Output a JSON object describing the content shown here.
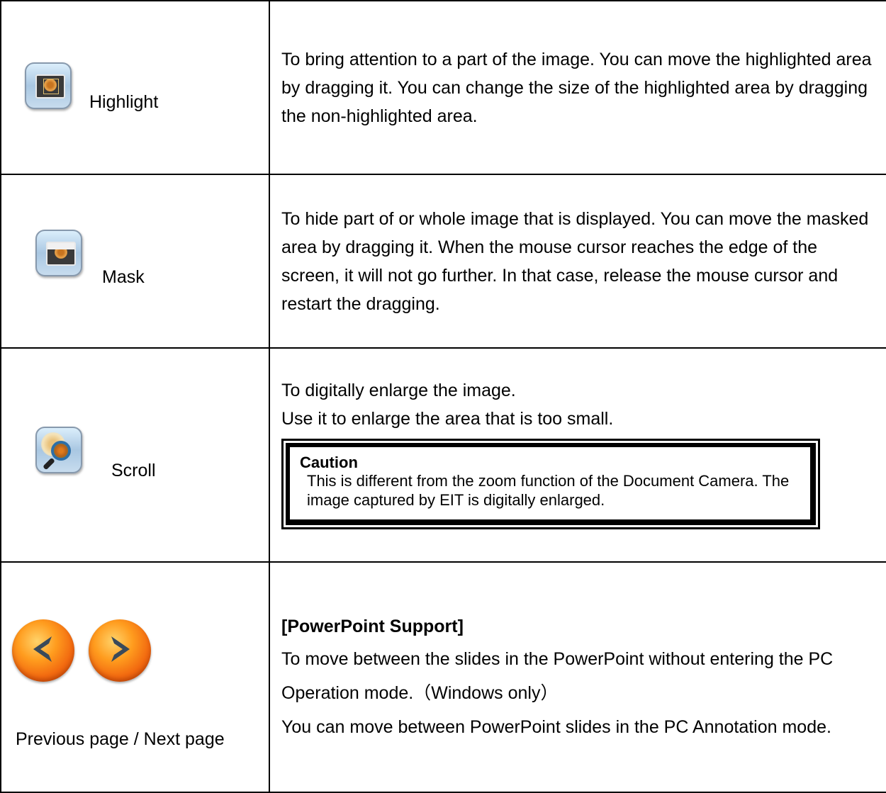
{
  "rows": [
    {
      "icon": "highlight-icon",
      "label": "Highlight",
      "description": "To bring attention to a part of the image. You can move the highlighted area by dragging it. You can change the size of the highlighted area by dragging the non-highlighted area."
    },
    {
      "icon": "mask-icon",
      "label": "Mask",
      "description": "To hide part of or whole image that is displayed. You can move the masked area by dragging it. When the mouse cursor reaches the edge of the screen, it will not go further. In that case, release the mouse cursor and restart the dragging."
    },
    {
      "icon": "magnifier-icon",
      "label": "Scroll",
      "description_line1": "To digitally enlarge the image.",
      "description_line2": "Use it to enlarge the area that is too small.",
      "caution": {
        "title": "Caution",
        "body": "This is different from the zoom function of the Document Camera. The image captured by EIT is digitally enlarged."
      }
    },
    {
      "icons": [
        "previous-page-icon",
        "next-page-icon"
      ],
      "label": "Previous page / Next page",
      "heading": "[PowerPoint Support]",
      "description_line1": "To move between the slides in the PowerPoint without entering the PC Operation mode.（Windows only）",
      "description_line2": "You can move between PowerPoint slides in the PC Annotation mode."
    }
  ],
  "colors": {
    "border": "#000000",
    "nav_button": "#f26a10",
    "icon_frame": "#a9c7e2"
  }
}
